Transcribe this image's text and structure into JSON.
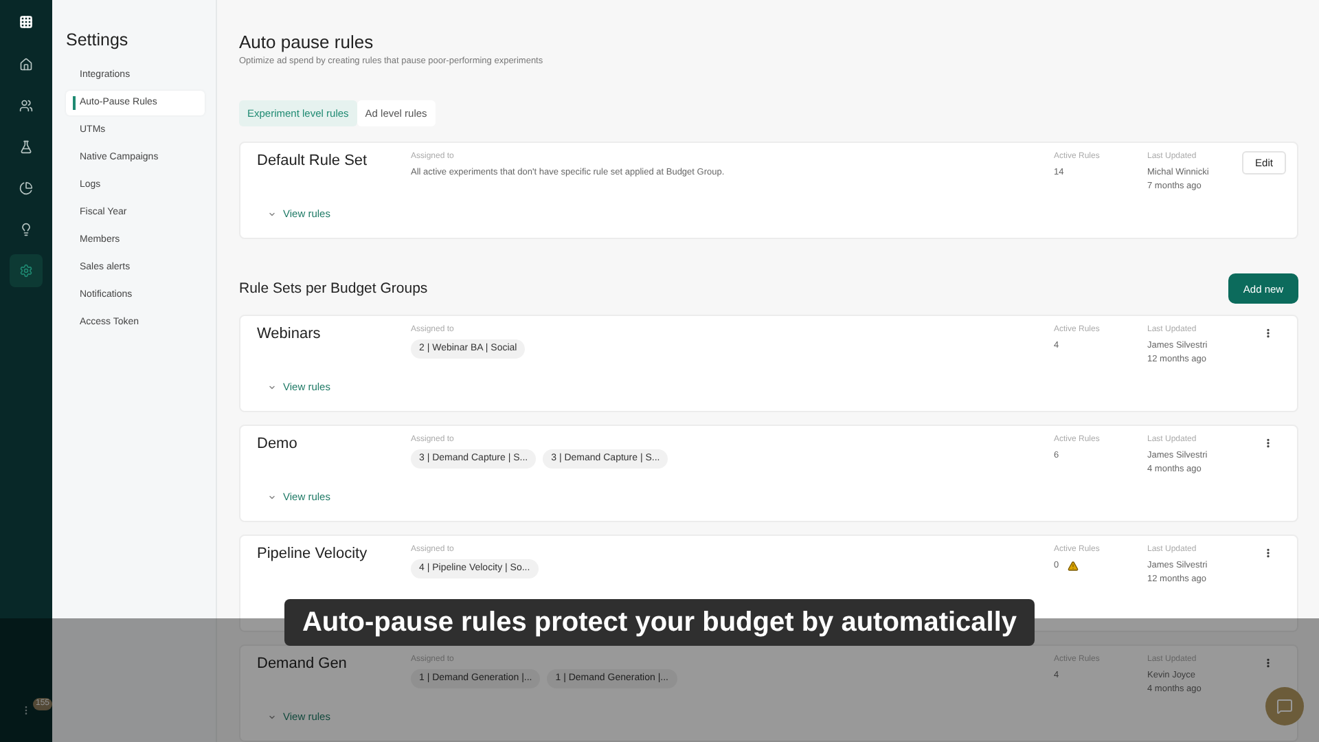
{
  "nav": [
    {
      "kind": "home",
      "selected": false
    },
    {
      "kind": "users",
      "selected": false
    },
    {
      "kind": "flask",
      "selected": false
    },
    {
      "kind": "pie",
      "selected": false
    },
    {
      "kind": "bulb",
      "selected": false
    },
    {
      "kind": "gear",
      "selected": true
    }
  ],
  "nav_badge": "155",
  "settings": {
    "title": "Settings",
    "items": [
      {
        "label": "Integrations",
        "selected": false
      },
      {
        "label": "Auto-Pause Rules",
        "selected": true
      },
      {
        "label": "UTMs",
        "selected": false
      },
      {
        "label": "Native Campaigns",
        "selected": false
      },
      {
        "label": "Logs",
        "selected": false
      },
      {
        "label": "Fiscal Year",
        "selected": false
      },
      {
        "label": "Members",
        "selected": false
      },
      {
        "label": "Sales alerts",
        "selected": false
      },
      {
        "label": "Notifications",
        "selected": false
      },
      {
        "label": "Access Token",
        "selected": false
      }
    ]
  },
  "page": {
    "title": "Auto pause rules",
    "subtitle": "Optimize ad spend by creating rules that pause poor-performing experiments"
  },
  "tabs": [
    {
      "label": "Experiment level rules",
      "selected": true
    },
    {
      "label": "Ad level rules",
      "selected": false
    }
  ],
  "default_rule_set": {
    "name": "Default Rule Set",
    "assigned_label": "Assigned to",
    "assigned_text": "All active experiments that don't have specific rule set applied at Budget Group.",
    "active_rules_label": "Active Rules",
    "active_rules": "14",
    "last_updated_label": "Last Updated",
    "updated_by": "Michal Winnicki",
    "updated_ago": "7 months ago",
    "action": "Edit",
    "view_rules": "View rules"
  },
  "section": {
    "title": "Rule Sets per Budget Groups",
    "add_button": "Add new"
  },
  "rule_sets": [
    {
      "name": "Webinars",
      "assigned_label": "Assigned to",
      "tags": [
        "2 | Webinar BA | Social"
      ],
      "active_rules_label": "Active Rules",
      "active_rules": "4",
      "warning": false,
      "last_updated_label": "Last Updated",
      "updated_by": "James Silvestri",
      "updated_ago": "12 months ago",
      "view_rules": "View rules"
    },
    {
      "name": "Demo",
      "assigned_label": "Assigned to",
      "tags": [
        "3 | Demand Capture | S...",
        "3 | Demand Capture | S..."
      ],
      "active_rules_label": "Active Rules",
      "active_rules": "6",
      "warning": false,
      "last_updated_label": "Last Updated",
      "updated_by": "James Silvestri",
      "updated_ago": "4 months ago",
      "view_rules": "View rules"
    },
    {
      "name": "Pipeline Velocity",
      "assigned_label": "Assigned to",
      "tags": [
        "4 | Pipeline Velocity | So..."
      ],
      "active_rules_label": "Active Rules",
      "active_rules": "0",
      "warning": true,
      "last_updated_label": "Last Updated",
      "updated_by": "James Silvestri",
      "updated_ago": "12 months ago"
    },
    {
      "name": "Demand Gen",
      "assigned_label": "Assigned to",
      "tags": [
        "1 | Demand Generation |...",
        "1 | Demand Generation |..."
      ],
      "active_rules_label": "Active Rules",
      "active_rules": "4",
      "warning": false,
      "last_updated_label": "Last Updated",
      "updated_by": "Kevin Joyce",
      "updated_ago": "4 months ago",
      "view_rules": "View rules"
    }
  ],
  "caption": "Auto-pause rules protect your budget by automatically"
}
